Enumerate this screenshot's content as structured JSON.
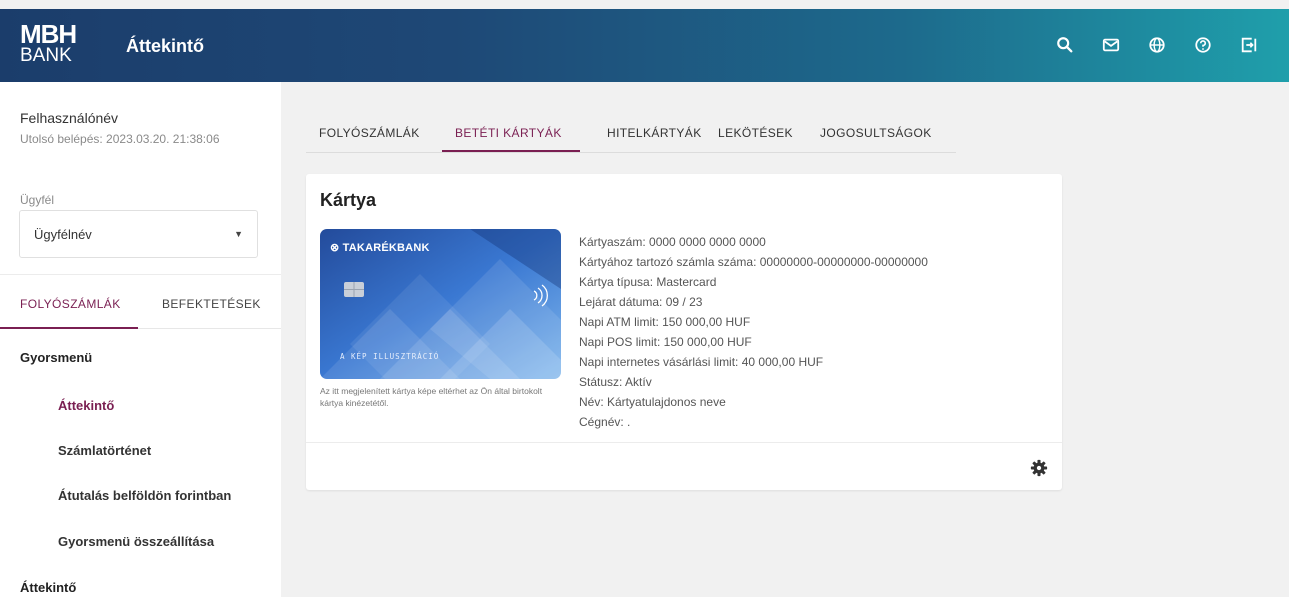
{
  "header": {
    "logo_line1": "MBH",
    "logo_line2": "BANK",
    "title": "Áttekintő",
    "icons": [
      "search-icon",
      "mail-icon",
      "globe-icon",
      "help-icon",
      "logout-icon"
    ],
    "gradient_colors": [
      "#1b3d6b",
      "#1f9fab"
    ]
  },
  "sidebar": {
    "username": "Felhasználónév",
    "last_login": "Utolsó belépés: 2023.03.20. 21:38:06",
    "client_label": "Ügyfél",
    "client_value": "Ügyfélnév",
    "tabs": [
      {
        "label": "FOLYÓSZÁMLÁK",
        "active": true
      },
      {
        "label": "BEFEKTETÉSEK",
        "active": false
      }
    ],
    "menu": {
      "quick_menu": "Gyorsmenü",
      "items": [
        {
          "label": "Áttekintő",
          "active": true
        },
        {
          "label": "Számlatörténet",
          "active": false
        },
        {
          "label": "Átutalás belföldön forintban",
          "active": false
        },
        {
          "label": "Gyorsmenü összeállítása",
          "active": false
        }
      ],
      "overview": "Áttekintő"
    }
  },
  "main": {
    "tabs": [
      {
        "label": "FOLYÓSZÁMLÁK",
        "active": false
      },
      {
        "label": "BETÉTI KÁRTYÁK",
        "active": true
      },
      {
        "label": "HITELKÁRTYÁK",
        "active": false
      },
      {
        "label": "LEKÖTÉSEK",
        "active": false
      },
      {
        "label": "JOGOSULTSÁGOK",
        "active": false
      }
    ],
    "card": {
      "title": "Kártya",
      "brand": "⊗ TAKARÉKBANK",
      "illustration_label": "A KÉP ILLUSZTRÁCIÓ",
      "note": "Az itt megjelenített kártya képe eltérhet az Ön által birtokolt kártya kinézetétől.",
      "info": [
        "Kártyaszám: 0000 0000 0000 0000",
        "Kártyához tartozó számla száma: 00000000-00000000-00000000",
        "Kártya típusa: Mastercard",
        "Lejárat dátuma: 09 / 23",
        "Napi ATM limit: 150 000,00 HUF",
        "Napi POS limit: 150 000,00 HUF",
        "Napi internetes vásárlási limit: 40 000,00 HUF",
        "Státusz: Aktív",
        "Név: Kártyatulajdonos neve",
        "Cégnév: ."
      ]
    }
  },
  "colors": {
    "accent": "#7a1f52",
    "card_blue": "#3d7fd6"
  }
}
